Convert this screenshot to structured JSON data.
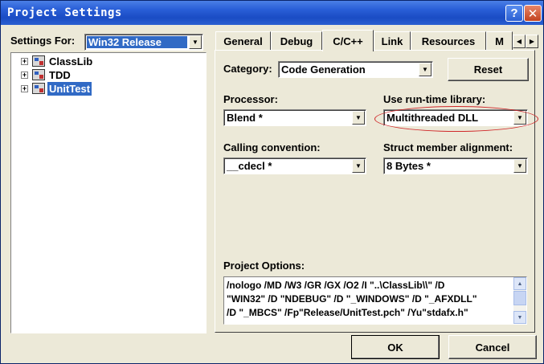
{
  "window": {
    "title": "Project Settings",
    "help_symbol": "?",
    "close_symbol": "✕"
  },
  "left_pane": {
    "settings_for_label": "Settings For:",
    "settings_for_value": "Win32 Release",
    "tree": [
      {
        "label": "ClassLib",
        "expander": "+",
        "selected": false
      },
      {
        "label": "TDD",
        "expander": "+",
        "selected": false
      },
      {
        "label": "UnitTest",
        "expander": "+",
        "selected": true
      }
    ]
  },
  "tabs": [
    {
      "label": "General",
      "active": false
    },
    {
      "label": "Debug",
      "active": false
    },
    {
      "label": "C/C++",
      "active": true
    },
    {
      "label": "Link",
      "active": false
    },
    {
      "label": "Resources",
      "active": false
    },
    {
      "label": "M",
      "active": false
    }
  ],
  "tab_scroll": {
    "left": "◀",
    "right": "▶"
  },
  "cpp_page": {
    "category_label": "Category:",
    "category_value": "Code Generation",
    "reset_button": "Reset",
    "processor_label": "Processor:",
    "processor_value": "Blend *",
    "runtime_label": "Use run-time library:",
    "runtime_value": "Multithreaded DLL",
    "calling_label": "Calling convention:",
    "calling_value": "__cdecl *",
    "alignment_label": "Struct member alignment:",
    "alignment_value": "8 Bytes *",
    "project_options_label": "Project Options:",
    "project_options_text": "/nologo /MD /W3 /GR /GX /O2 /I \"..\\ClassLib\\\\\" /D\n\"WIN32\" /D \"NDEBUG\" /D \"_WINDOWS\" /D \"_AFXDLL\"\n/D \"_MBCS\" /Fp\"Release/UnitTest.pch\" /Yu\"stdafx.h\""
  },
  "footer": {
    "ok_button": "OK",
    "cancel_button": "Cancel"
  },
  "icons": {
    "dropdown_arrow": "▼",
    "scroll_up": "▲",
    "scroll_down": "▼"
  },
  "colors": {
    "title_bar": "#2a5fd8",
    "selection": "#316ac5",
    "dialog_bg": "#ece9d8",
    "highlight_ellipse": "#d0282a"
  }
}
